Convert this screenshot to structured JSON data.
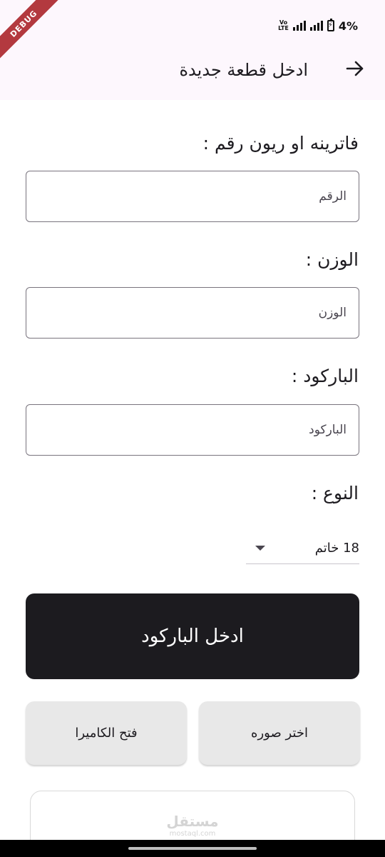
{
  "status_bar": {
    "volte": "Vo\nLTE",
    "battery": "4%"
  },
  "debug_banner": "DEBUG",
  "app_bar": {
    "title": "ادخل قطعة جديدة",
    "back_icon": "arrow-right-icon"
  },
  "form": {
    "showcase_label": "فاترينه او ريون رقم  :",
    "showcase_placeholder": "الرقم",
    "weight_label": "الوزن :",
    "weight_placeholder": "الوزن",
    "barcode_label": "الباركود :",
    "barcode_placeholder": "الباركود",
    "type_label": "النوع :",
    "type_value": "18 خاتم"
  },
  "buttons": {
    "enter_barcode": "ادخل الباركود",
    "choose_image": "اختر صوره",
    "open_camera": "فتح الكاميرا"
  },
  "watermark": {
    "main": "مستقل",
    "sub": "mostaql.com"
  },
  "colors": {
    "app_bar_bg": "#fdf7fd",
    "primary_button": "#1c1b1f",
    "secondary_button": "#e8e8e8",
    "debug_banner": "#b3393f"
  }
}
